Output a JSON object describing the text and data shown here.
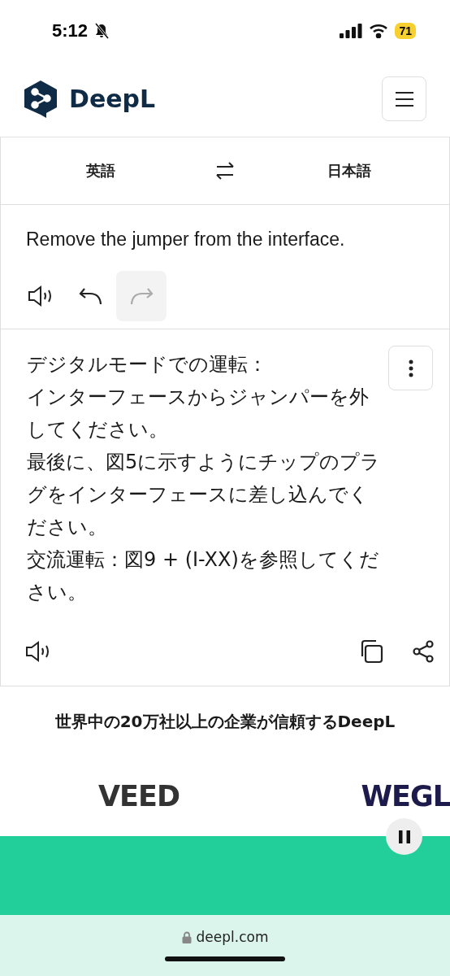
{
  "status_bar": {
    "time": "5:12",
    "battery": "71"
  },
  "header": {
    "brand": "DeepL"
  },
  "languages": {
    "source": "英語",
    "target": "日本語"
  },
  "source": {
    "lines": [
      "Remove the jumper from the interface."
    ],
    "toolbar": [
      {
        "kind": "speaker",
        "disabled": false
      },
      {
        "kind": "undo",
        "disabled": false
      },
      {
        "kind": "redo",
        "disabled": true
      }
    ]
  },
  "target": {
    "paragraphs": [
      "デジタルモードでの運転：",
      "インターフェースからジャンパーを外してください。",
      "最後に、図5に示すようにチップのプラグをインターフェースに差し込んでください。",
      "交流運転：図9 + (I-XX)を参照してください。"
    ]
  },
  "trusted": {
    "heading": "世界中の20万社以上の企業が信頼するDeepL",
    "logos": [
      {
        "name": "VEED",
        "color": "#333333"
      },
      {
        "name": "WEGL",
        "color": "#1d1b4b"
      }
    ]
  },
  "browser": {
    "url": "deepl.com"
  }
}
